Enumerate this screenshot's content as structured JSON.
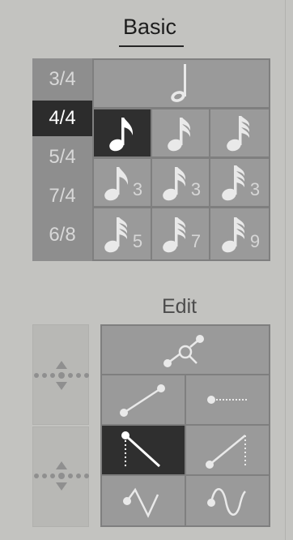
{
  "basic": {
    "title": "Basic",
    "time_signatures": [
      {
        "label": "3/4",
        "selected": false
      },
      {
        "label": "4/4",
        "selected": true
      },
      {
        "label": "5/4",
        "selected": false
      },
      {
        "label": "7/4",
        "selected": false
      },
      {
        "label": "6/8",
        "selected": false
      }
    ],
    "notes": [
      {
        "icon": "half-note-icon",
        "selected": false
      },
      {
        "icon": "eighth-note-icon",
        "selected": true
      },
      {
        "icon": "sixteenth-note-icon",
        "selected": false
      },
      {
        "icon": "thirty-second-note-icon",
        "selected": false
      },
      {
        "icon": "eighth-triplet-icon",
        "tuplet": "3",
        "selected": false
      },
      {
        "icon": "sixteenth-triplet-icon",
        "tuplet": "3",
        "selected": false
      },
      {
        "icon": "thirty-second-triplet-icon",
        "tuplet": "3",
        "selected": false
      },
      {
        "icon": "sixteenth-quintuplet-icon",
        "tuplet": "5",
        "selected": false
      },
      {
        "icon": "sixteenth-septuplet-icon",
        "tuplet": "7",
        "selected": false
      },
      {
        "icon": "thirty-second-nonuplet-icon",
        "tuplet": "9",
        "selected": false
      }
    ]
  },
  "edit": {
    "title": "Edit",
    "sliders": [
      {
        "icon": "move-handle-icon"
      },
      {
        "icon": "move-handle-icon"
      }
    ],
    "tools": [
      {
        "icon": "node-zoom-icon",
        "selected": false
      },
      {
        "icon": "line-ramp-icon",
        "selected": false
      },
      {
        "icon": "dotted-line-icon",
        "selected": false
      },
      {
        "icon": "ramp-down-icon",
        "selected": true
      },
      {
        "icon": "ramp-up-icon",
        "selected": false
      },
      {
        "icon": "triangle-wave-icon",
        "selected": false
      },
      {
        "icon": "sine-wave-icon",
        "selected": false
      }
    ]
  },
  "colors": {
    "panel_bg": "#c3c3c0",
    "cell_bg": "#9a9a9a",
    "selected_bg": "#2f2f2f",
    "icon_color": "#e9e9e9"
  }
}
